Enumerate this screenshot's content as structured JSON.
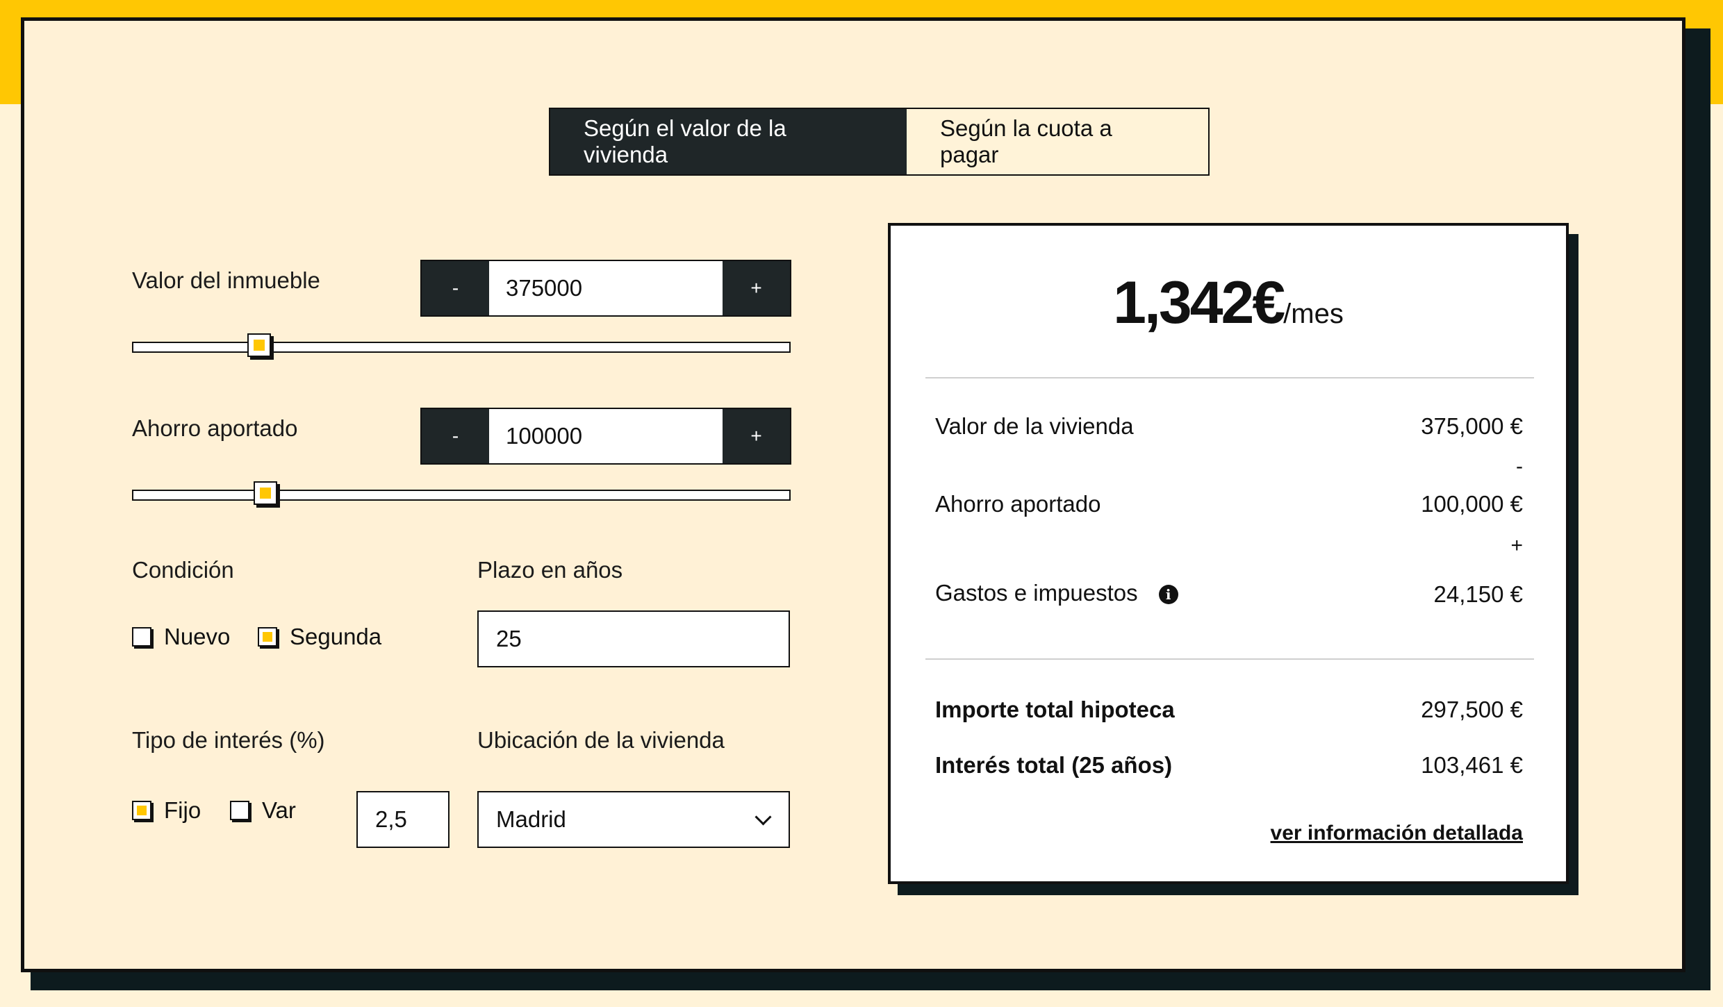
{
  "tabs": {
    "by_value": "Según el valor de la vivienda",
    "by_payment": "Según la cuota a pagar"
  },
  "property_value": {
    "label": "Valor del inmueble",
    "minus": "-",
    "value": "375000",
    "plus": "+",
    "slider_fraction": 0.18
  },
  "savings": {
    "label": "Ahorro aportado",
    "minus": "-",
    "value": "100000",
    "plus": "+",
    "slider_fraction": 0.19
  },
  "condition": {
    "label": "Condición",
    "options": [
      {
        "label": "Nuevo",
        "checked": false
      },
      {
        "label": "Segunda",
        "checked": true
      }
    ]
  },
  "term": {
    "label": "Plazo en años",
    "value": "25"
  },
  "interest": {
    "label": "Tipo de interés (%)",
    "options": [
      {
        "label": "Fijo",
        "checked": true
      },
      {
        "label": "Var",
        "checked": false
      }
    ],
    "value": "2,5"
  },
  "location": {
    "label": "Ubicación de la vivienda",
    "value": "Madrid"
  },
  "result": {
    "monthly": "1,342€",
    "per": "/mes",
    "rows": [
      {
        "label": "Valor de la vivienda",
        "value": "375,000 €"
      },
      {
        "label": "Ahorro aportado",
        "value": "100,000 €"
      },
      {
        "label": "Gastos e impuestos",
        "value": "24,150 €"
      }
    ],
    "ops": [
      "-",
      "+"
    ],
    "totals": [
      {
        "label": "Importe total hipoteca",
        "value": "297,500 €"
      },
      {
        "label": "Interés total (25 años)",
        "value": "103,461 €"
      }
    ],
    "link": "ver información detallada"
  },
  "colors": {
    "accent": "#ffc703",
    "dark": "#1f2628",
    "background": "#fff3d8"
  }
}
